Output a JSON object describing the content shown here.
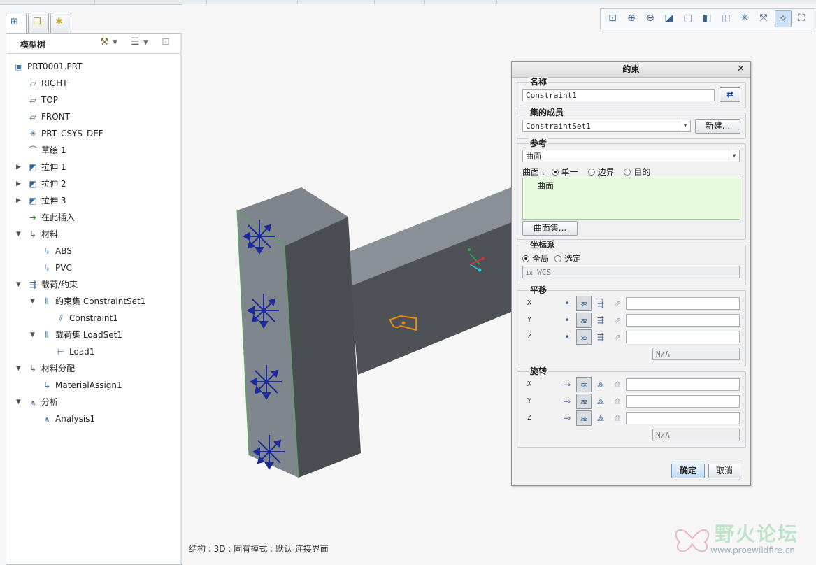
{
  "left_tabs": [
    "model-tree-tab",
    "layer-tree-tab",
    "favorites-tab"
  ],
  "tree": {
    "title": "模型树",
    "nodes": [
      {
        "label": "PRT0001.PRT",
        "icon": "part-icon",
        "level": 0,
        "expander": ""
      },
      {
        "label": "RIGHT",
        "icon": "datum-plane-icon",
        "level": 1,
        "expander": ""
      },
      {
        "label": "TOP",
        "icon": "datum-plane-icon",
        "level": 1,
        "expander": ""
      },
      {
        "label": "FRONT",
        "icon": "datum-plane-icon",
        "level": 1,
        "expander": ""
      },
      {
        "label": "PRT_CSYS_DEF",
        "icon": "csys-icon",
        "level": 1,
        "expander": ""
      },
      {
        "label": "草绘 1",
        "icon": "sketch-icon",
        "level": 1,
        "expander": ""
      },
      {
        "label": "拉伸 1",
        "icon": "extrude-icon",
        "level": 1,
        "expander": "▶"
      },
      {
        "label": "拉伸 2",
        "icon": "extrude-icon",
        "level": 1,
        "expander": "▶"
      },
      {
        "label": "拉伸 3",
        "icon": "extrude-icon",
        "level": 1,
        "expander": "▶"
      },
      {
        "label": "在此插入",
        "icon": "insert-here-arrow-icon",
        "level": 1,
        "expander": ""
      },
      {
        "label": "材料",
        "icon": "material-icon",
        "level": 1,
        "expander": "▼"
      },
      {
        "label": "ABS",
        "icon": "material-icon",
        "level": 2,
        "expander": ""
      },
      {
        "label": "PVC",
        "icon": "material-icon",
        "level": 2,
        "expander": ""
      },
      {
        "label": "载荷/约束",
        "icon": "loads-constraints-icon",
        "level": 1,
        "expander": "▼"
      },
      {
        "label": "约束集 ConstraintSet1",
        "icon": "constraint-set-icon",
        "level": 2,
        "expander": "▼"
      },
      {
        "label": "Constraint1",
        "icon": "constraint-icon",
        "level": 3,
        "expander": ""
      },
      {
        "label": "载荷集 LoadSet1",
        "icon": "load-set-icon",
        "level": 2,
        "expander": "▼"
      },
      {
        "label": "Load1",
        "icon": "load-icon",
        "level": 3,
        "expander": ""
      },
      {
        "label": "材料分配",
        "icon": "material-assign-icon",
        "level": 1,
        "expander": "▼"
      },
      {
        "label": "MaterialAssign1",
        "icon": "material-assign-icon",
        "level": 2,
        "expander": ""
      },
      {
        "label": "分析",
        "icon": "analysis-icon",
        "level": 1,
        "expander": "▼"
      },
      {
        "label": "Analysis1",
        "icon": "analysis-icon",
        "level": 2,
        "expander": ""
      }
    ]
  },
  "view_toolbar": [
    "zoom-fit-icon",
    "zoom-in-icon",
    "zoom-out-icon",
    "repaint-icon",
    "display-style-icon",
    "saved-views-icon",
    "view-manager-icon",
    "datum-display-icon",
    "spin-center-icon",
    "annotation-display-icon",
    "simulation-display-icon"
  ],
  "status_text": "结构 : 3D : 固有模式 : 默认 连接界面",
  "watermark": {
    "title": "野火论坛",
    "url": "www.proewildfire.cn"
  },
  "dialog": {
    "title": "约束",
    "name_label": "名称",
    "name_value": "Constraint1",
    "set_label": "集的成员",
    "set_value": "ConstraintSet1",
    "new_button": "新建...",
    "refs_label": "参考",
    "refs_type": "曲面",
    "surface_prefix": "曲面 :",
    "surface_options": [
      "单一",
      "边界",
      "目的"
    ],
    "refs_list": [
      "曲面"
    ],
    "surface_sets_button": "曲面集...",
    "csys_label": "坐标系",
    "csys_options": [
      "全局",
      "选定"
    ],
    "csys_value": "WCS",
    "translation_label": "平移",
    "rotation_label": "旋转",
    "axes": [
      "X",
      "Y",
      "Z"
    ],
    "na_text": "N/A",
    "ok_button": "确定",
    "cancel_button": "取消"
  }
}
